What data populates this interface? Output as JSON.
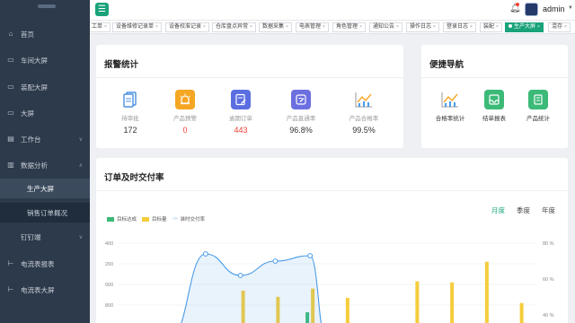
{
  "sidebar": {
    "items": [
      {
        "label": "首页",
        "icon": "home-icon"
      },
      {
        "label": "车间大屏",
        "icon": "monitor-icon"
      },
      {
        "label": "装配大屏",
        "icon": "monitor-icon"
      },
      {
        "label": "大屏",
        "icon": "monitor-icon"
      },
      {
        "label": "工作台",
        "icon": "desk-icon"
      },
      {
        "label": "数据分析",
        "icon": "chart-icon"
      },
      {
        "label": "生产大屏",
        "icon": ""
      },
      {
        "label": "销售订单概况",
        "icon": ""
      },
      {
        "label": "钉钉端",
        "icon": "dingtalk-icon"
      },
      {
        "label": "电流表报表",
        "icon": "meter-icon"
      },
      {
        "label": "电流表大屏",
        "icon": "meter-icon"
      }
    ]
  },
  "header": {
    "username": "admin"
  },
  "tabs": [
    "工单",
    "设备维修记录单",
    "设备校准记录",
    "仓库盘点异常",
    "数据采集",
    "电表管理",
    "角色管理",
    "通知公告",
    "操作日志",
    "登录日志",
    "装配",
    "生产大屏",
    "混存"
  ],
  "alarm_stats": {
    "title": "报警统计",
    "items": [
      {
        "label": "待审批",
        "value": "172",
        "color": "#4a90e2"
      },
      {
        "label": "产品预警",
        "value": "0",
        "color": "#f5a623"
      },
      {
        "label": "逾期订单",
        "value": "443",
        "color": "#5b6ee1"
      },
      {
        "label": "产品直通率",
        "value": "96.8%",
        "color": "#6c6fe0"
      },
      {
        "label": "产品合格率",
        "value": "99.5%",
        "color": "#f5a623"
      }
    ],
    "value_colors": {
      "产品预警": "#f04134",
      "逾期订单": "#f04134"
    }
  },
  "quick_nav": {
    "title": "便捷导航",
    "items": [
      {
        "label": "合格率统计"
      },
      {
        "label": "结单报表"
      },
      {
        "label": "产品统计"
      }
    ]
  },
  "order_chart": {
    "title": "订单及时交付率",
    "periods": [
      "月度",
      "季度",
      "年度"
    ],
    "active_period": "月度"
  },
  "chart_data": {
    "type": "bar",
    "legend": [
      "目标达成",
      "目标量",
      "准时交付率"
    ],
    "colors": {
      "目标达成": "#3cba78",
      "目标量": "#f5cd3d",
      "准时交付率": "#4a9be8"
    },
    "y_left_ticks": [
      "400",
      "200",
      "000",
      "800",
      "600"
    ],
    "y_right_ticks": [
      "80 %",
      "60 %",
      "40 %"
    ],
    "series": [
      {
        "name": "目标量",
        "values": [
          null,
          null,
          null,
          940,
          880,
          960,
          870,
          null,
          1030,
          1020,
          1220,
          820
        ]
      },
      {
        "name": "目标达成",
        "values": [
          null,
          null,
          null,
          null,
          null,
          730,
          null,
          null,
          null,
          null,
          null,
          null
        ]
      },
      {
        "name": "准时交付率",
        "values": [
          null,
          28,
          74,
          62,
          70,
          73,
          null,
          null,
          null,
          null,
          null,
          null
        ]
      }
    ]
  }
}
